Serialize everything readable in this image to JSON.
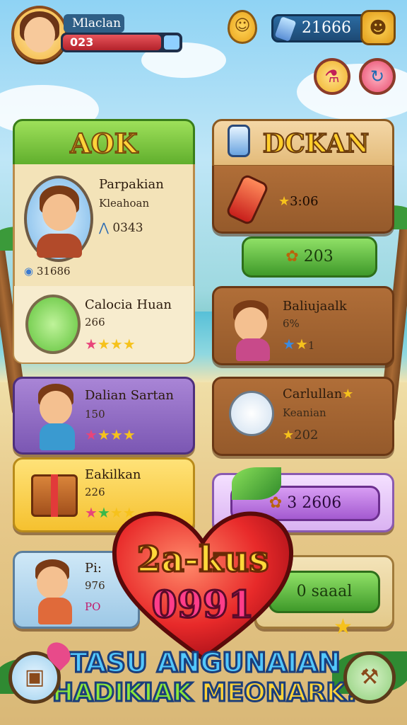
{
  "hud": {
    "player_name": "Mlaclan",
    "player_value": "023",
    "currency_value": "21666",
    "coin_pin_icon": "smiley-coin-icon",
    "coin_face_icon": "coin-face-icon"
  },
  "left_column": {
    "header": "AOK",
    "items": [
      {
        "title": "Parpakian",
        "subtitle": "Kleahoan",
        "value": "0343",
        "footer": "31686"
      },
      {
        "title": "Calocia Huan",
        "value": "266",
        "stars": "★★★★"
      },
      {
        "title": "Dalian Sartan",
        "value": "150",
        "stars": "★★★★"
      },
      {
        "title": "Eakilkan",
        "value": "226",
        "stars": "★★★★"
      },
      {
        "title": "Pi:",
        "value": "976",
        "extra": "PO"
      }
    ]
  },
  "right_column": {
    "header": "DCKAN",
    "potion_value": "3:06",
    "green_button": "203",
    "items": [
      {
        "title": "Baliujaalk",
        "value": "6%",
        "stars": "★★",
        "extra": "1"
      },
      {
        "title": "Carlullan",
        "subtitle": "Keanian",
        "value": "202"
      }
    ],
    "purple_button": "3 2606",
    "bottom_button": "0 saaal"
  },
  "promo": {
    "line1": "2a-kus",
    "line2": "0991"
  },
  "banner": {
    "line1": "TASU ANGUNAIAN",
    "line2a": "HADIKIAK",
    "line2b": "MEONARK!"
  },
  "colors": {
    "green": "#5fae2c",
    "purple": "#a45ad0",
    "wood": "#955a2b",
    "gold": "#ffd33a"
  }
}
